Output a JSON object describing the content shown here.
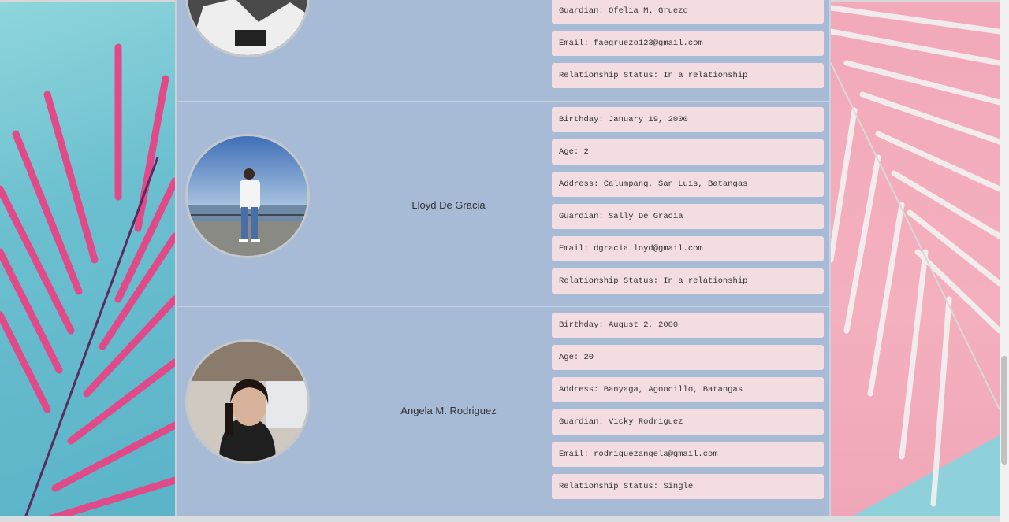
{
  "profiles": [
    {
      "name": "",
      "fields": [
        "Guardian: Ofelia M. Gruezo",
        "Email: faegruezo123@gmail.com",
        "Relationship Status: In a relationship"
      ]
    },
    {
      "name": "Lloyd De Gracia",
      "fields": [
        "Birthday: January 19, 2000",
        "Age: 2",
        "Address: Calumpang, San Luis, Batangas",
        "Guardian: Sally De Gracia",
        "Email: dgracia.loyd@gmail.com",
        "Relationship Status: In a relationship"
      ]
    },
    {
      "name": "Angela M. Rodriguez",
      "fields": [
        "Birthday: August 2, 2000",
        "Age: 20",
        "Address: Banyaga, Agoncillo, Batangas",
        "Guardian: Vicky Rodriguez",
        "Email: rodriguezangela@gmail.com",
        "Relationship Status: Single"
      ]
    }
  ],
  "colors": {
    "panel": "#a7bad6",
    "field_bg": "#f3dde0",
    "bg_teal": "#7ec9d3",
    "bg_pink": "#f2a9b9",
    "leaf_pink": "#e84b8a"
  },
  "icons": [
    "palm-leaf-left",
    "palm-leaf-right",
    "avatar-photo"
  ]
}
